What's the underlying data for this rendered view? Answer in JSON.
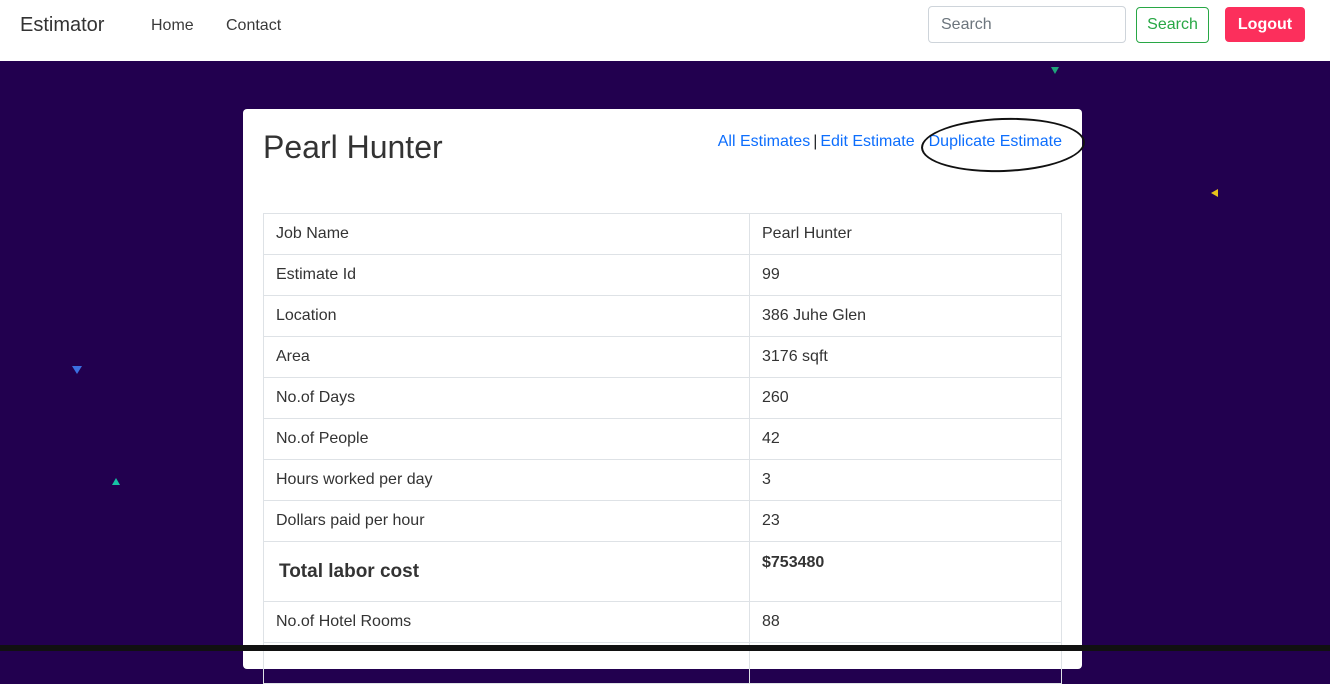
{
  "navbar": {
    "brand": "Estimator",
    "links": [
      "Home",
      "Contact"
    ],
    "search_placeholder": "Search",
    "search_button": "Search",
    "logout_button": "Logout"
  },
  "card": {
    "title": "Pearl Hunter",
    "actions": {
      "all_estimates": "All Estimates",
      "separator": "|",
      "edit_estimate": "Edit Estimate",
      "duplicate_estimate": "Duplicate Estimate"
    },
    "rows": [
      {
        "label": "Job Name",
        "value": "Pearl Hunter"
      },
      {
        "label": "Estimate Id",
        "value": "99"
      },
      {
        "label": "Location",
        "value": "386 Juhe Glen"
      },
      {
        "label": "Area",
        "value": "3176 sqft"
      },
      {
        "label": "No.of Days",
        "value": "260"
      },
      {
        "label": "No.of People",
        "value": "42"
      },
      {
        "label": "Hours worked per day",
        "value": "3"
      },
      {
        "label": "Dollars paid per hour",
        "value": "23"
      }
    ],
    "total": {
      "label": "Total labor cost",
      "value": "$753480"
    },
    "rows_after": [
      {
        "label": "No.of Hotel Rooms",
        "value": "88"
      }
    ]
  },
  "colors": {
    "background": "#22004f",
    "logout": "#fc2f5c",
    "search_outline": "#28a745",
    "link": "#0d6efd"
  }
}
